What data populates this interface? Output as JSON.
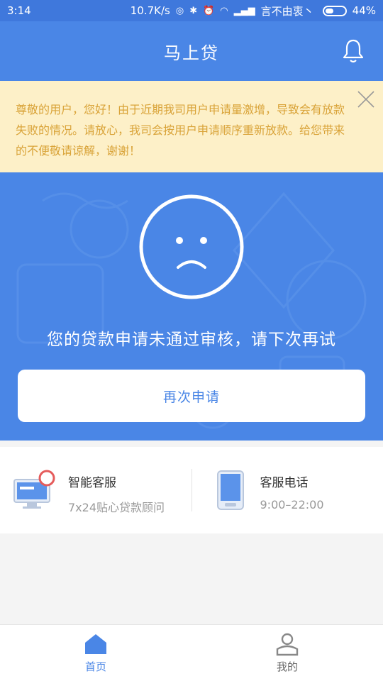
{
  "status_bar": {
    "time": "3:14",
    "speed": "10.7K/s",
    "carrier": "言不由衷丶",
    "battery": "44%",
    "battery_level": 0.44
  },
  "header": {
    "title": "马上贷"
  },
  "notice": {
    "text": "尊敬的用户，您好！由于近期我司用户申请量激增，导致会有放款失败的情况。请放心，我司会按用户申请顺序重新放款。给您带来的不便敬请谅解，谢谢！"
  },
  "result": {
    "message": "您的贷款申请未通过审核，请下次再试",
    "reapply_label": "再次申请"
  },
  "services": {
    "chat": {
      "title": "智能客服",
      "subtitle": "7x24贴心贷款顾问"
    },
    "phone": {
      "title": "客服电话",
      "subtitle": "9:00–22:00"
    }
  },
  "tabbar": {
    "home_label": "首页",
    "mine_label": "我的"
  },
  "colors": {
    "brand_blue": "#4a86e6",
    "notice_bg": "#fdf0c8",
    "notice_text": "#d9a338"
  }
}
